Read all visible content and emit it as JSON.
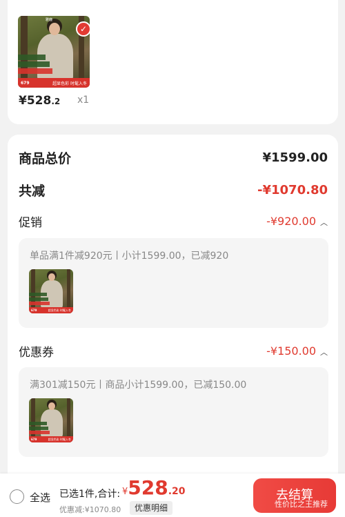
{
  "product": {
    "price_int": "¥528",
    "price_dec": ".2",
    "qty": "x1",
    "thumb_price": "679",
    "thumb_tag": "超显色彩 时髦入冬",
    "thumb_brand": "雅鹿"
  },
  "summary": {
    "total_label": "商品总价",
    "total_value": "¥1599.00",
    "reduce_label": "共减",
    "reduce_value": "-¥1070.80",
    "promo": {
      "label": "促销",
      "value": "-¥920.00",
      "detail": "单品满1件减920元丨小计1599.00，已减920"
    },
    "coupon": {
      "label": "优惠券",
      "value": "-¥150.00",
      "detail": "满301减150元丨商品小计1599.00，已减150.00"
    }
  },
  "footer": {
    "select_all": "全选",
    "selected_text": "已选1件,合计:",
    "currency": "¥",
    "total_int": "528",
    "total_dec": ".20",
    "discount_text": "优惠减:¥1070.80",
    "detail_button": "优惠明细",
    "checkout_button": "去结算",
    "watermark": "性价比之王推荐"
  },
  "icons": {
    "check": "check-icon",
    "caret_up": "caret-up-icon"
  },
  "colors": {
    "accent": "#e03a2f",
    "checkout": "#ef4640"
  }
}
